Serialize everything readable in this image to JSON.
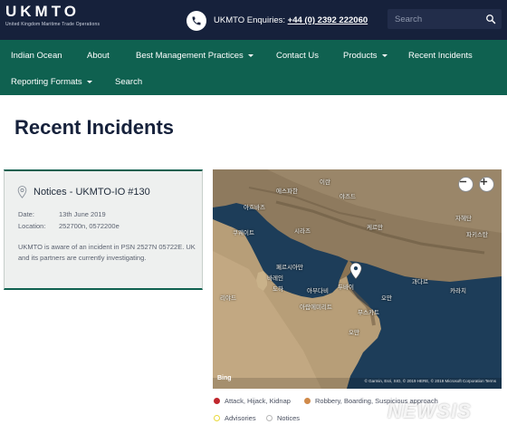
{
  "header": {
    "logo_text": "UKMTO",
    "logo_subtitle": "United Kingdom Maritime Trade Operations",
    "enquiries_label": "UKMTO Enquiries:",
    "enquiries_number": "+44 (0) 2392 222060",
    "search_placeholder": "Search"
  },
  "nav": {
    "items": [
      {
        "label": "Indian Ocean"
      },
      {
        "label": "About"
      },
      {
        "label": "Best Management Practices"
      },
      {
        "label": "Contact Us"
      },
      {
        "label": "Products"
      },
      {
        "label": "Recent Incidents"
      },
      {
        "label": "Reporting Formats"
      },
      {
        "label": "Search"
      }
    ]
  },
  "page": {
    "title": "Recent Incidents"
  },
  "notice": {
    "title": "Notices - UKMTO-IO #130",
    "date_label": "Date:",
    "date_value": "13th June 2019",
    "location_label": "Location:",
    "location_value": "252700n, 0572200e",
    "body": "UKMTO is aware of an incident in PSN 2527N 05722E. UK and its partners are currently investigating."
  },
  "map": {
    "labels": [
      {
        "text": "이란"
      },
      {
        "text": "에스파한"
      },
      {
        "text": "야즈드"
      },
      {
        "text": "아흐바즈"
      },
      {
        "text": "쿠웨이트"
      },
      {
        "text": "시라즈"
      },
      {
        "text": "케르만"
      },
      {
        "text": "자헤단"
      },
      {
        "text": "파키스탄"
      },
      {
        "text": "페르시아만"
      },
      {
        "text": "바레인"
      },
      {
        "text": "도하"
      },
      {
        "text": "리야드"
      },
      {
        "text": "아부다비"
      },
      {
        "text": "두바이"
      },
      {
        "text": "아랍에미리트"
      },
      {
        "text": "오만"
      },
      {
        "text": "무스카트"
      },
      {
        "text": "오만"
      },
      {
        "text": "카라치"
      },
      {
        "text": "과다르"
      }
    ],
    "bing_label": "Bing",
    "attribution": "© Garmin, Esri, SIO, © 2019 HERE, © 2019 Microsoft Corporation  Terms",
    "zoom_out_label": "−",
    "zoom_in_label": "+"
  },
  "legend": [
    {
      "label": "Attack, Hijack, Kidnap",
      "color": "#c0272d"
    },
    {
      "label": "Robbery, Boarding, Suspicious approach",
      "color": "#d08a4a"
    },
    {
      "label": "Advisories",
      "color": "#e9d93a"
    },
    {
      "label": "Notices",
      "color": "#ffffff"
    }
  ],
  "watermark": "NEWSIS",
  "colors": {
    "header_bg": "#16213b",
    "nav_bg": "#0f6150",
    "card_bg": "#eef0ef"
  }
}
